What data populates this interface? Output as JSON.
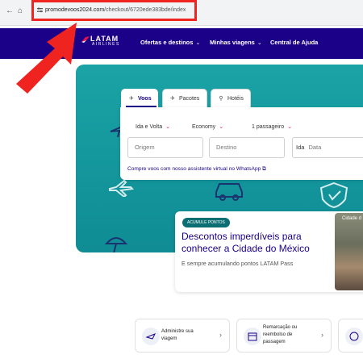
{
  "browser": {
    "url_host": "promodevoos2024.com",
    "url_path": "/checkout/6720ede383bde/index",
    "back_icon": "back-arrow-icon",
    "home_icon": "home-icon"
  },
  "header": {
    "logo_text": "LATAM",
    "logo_sub": "AIRLINES",
    "menu": [
      {
        "label": "Ofertas e destinos"
      },
      {
        "label": "Minhas viagens"
      },
      {
        "label": "Central de Ajuda"
      }
    ],
    "bg_color": "#1b0088"
  },
  "search": {
    "tabs": [
      {
        "label": "Voos",
        "icon": "plane-icon",
        "active": true
      },
      {
        "label": "Pacotes",
        "icon": "package-icon",
        "active": false
      },
      {
        "label": "Hotéis",
        "icon": "hotel-icon",
        "active": false
      }
    ],
    "trip_type": "Ida e Volta",
    "cabin": "Economy",
    "passengers": "1 passageiro",
    "origin_placeholder": "Origem",
    "destination_placeholder": "Destino",
    "date_prefix": "Ida",
    "date_placeholder": "Data",
    "whatsapp_link": "Compre voos com nosso assistente virtual no WhatsApp",
    "accent_color": "#e8114b"
  },
  "promo": {
    "badge": "ACUMULE PONTOS",
    "title": "Descontos imperdíveis para conhecer a Cidade do México",
    "subtitle": "E sempre acumulando pontos LATAM Pass",
    "photo_caption": "Cidade d"
  },
  "services": [
    {
      "label_line1": "Administre sua",
      "label_line2": "viagem",
      "icon": "plane-ticket-icon"
    },
    {
      "label_line1": "Remarcação ou",
      "label_line2": "reembolso de",
      "label_line3": "passagem",
      "icon": "calendar-icon"
    },
    {
      "icon": "money-icon"
    }
  ],
  "annotation": {
    "highlight_color": "#ef2320"
  }
}
